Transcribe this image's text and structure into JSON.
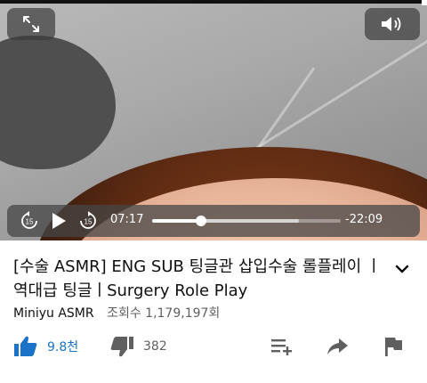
{
  "player": {
    "current_time": "07:17",
    "remaining_time": "-22:09",
    "rewind_seconds": "15",
    "forward_seconds": "15",
    "progress": 0.26,
    "buffered": 0.78,
    "fullscreen_icon": "fullscreen-arrows-icon",
    "volume_icon": "volume-icon",
    "play_icon": "play-icon"
  },
  "video": {
    "title": "[수술 ASMR] ENG SUB 팅글관 삽입수술 롤플레이 ㅣ역대급 팅글ㅣSurgery Role Play",
    "channel": "Miniyu ASMR",
    "views": "조회수 1,179,197회"
  },
  "actions": {
    "like_count": "9.8천",
    "dislike_count": "382",
    "like_icon": "thumbs-up-icon",
    "dislike_icon": "thumbs-down-icon",
    "add_playlist_icon": "add-to-playlist-icon",
    "share_icon": "share-icon",
    "report_icon": "flag-icon"
  },
  "colors": {
    "like_accent": "#1a73c9",
    "text_primary": "#0f0f0f",
    "text_secondary": "#606060"
  }
}
